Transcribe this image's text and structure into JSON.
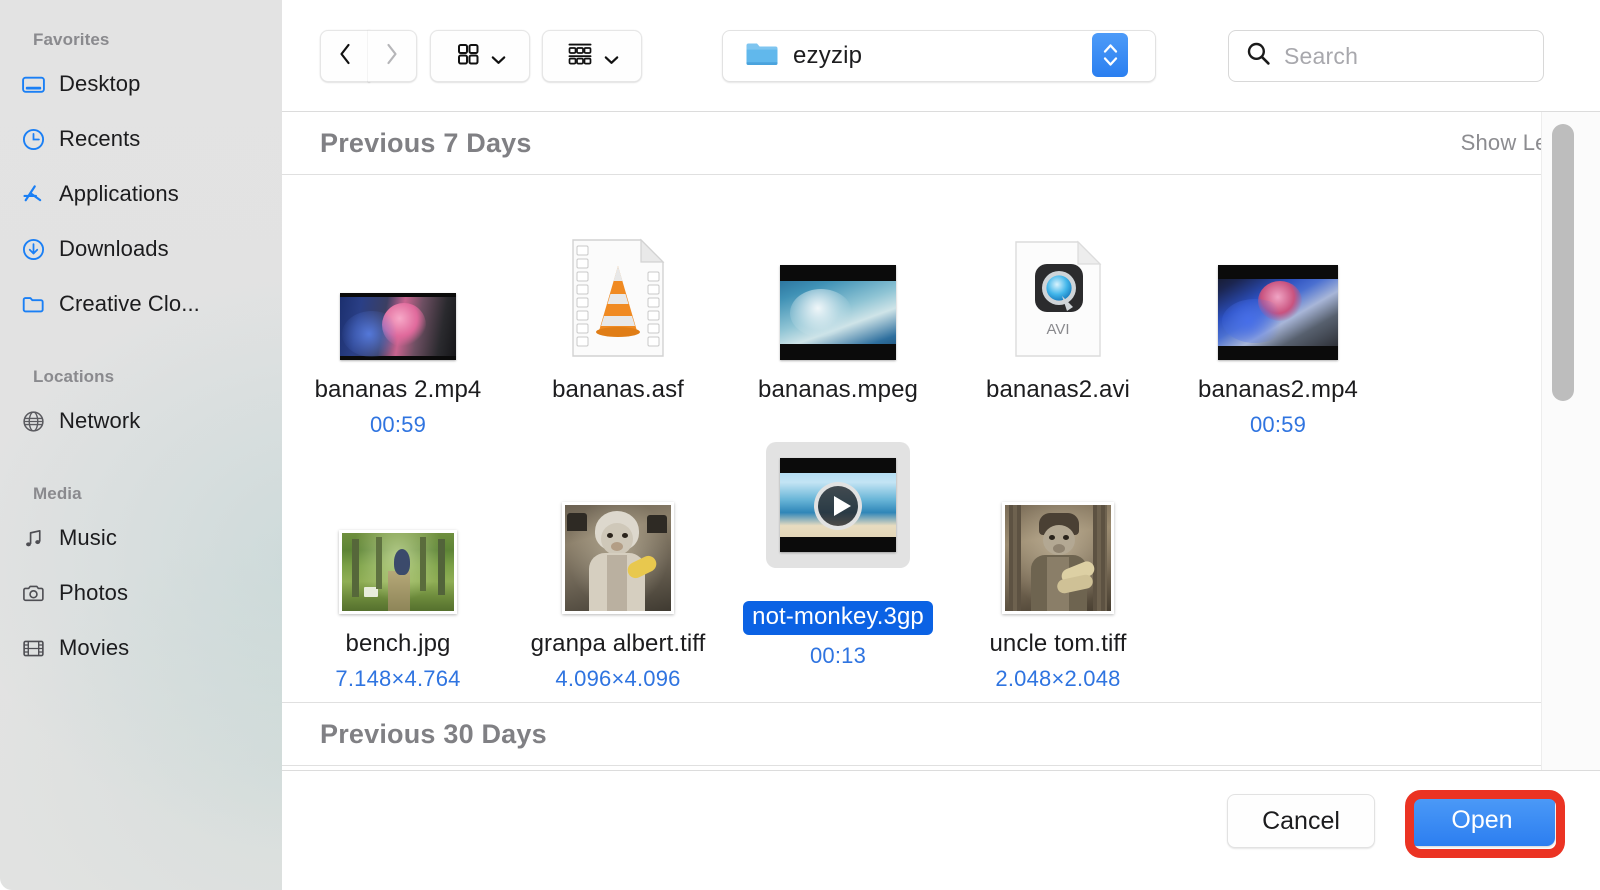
{
  "sidebar": {
    "groups": [
      {
        "title": "Favorites",
        "items": [
          {
            "label": "Desktop",
            "icon": "desktop-icon"
          },
          {
            "label": "Recents",
            "icon": "clock-icon"
          },
          {
            "label": "Applications",
            "icon": "applications-icon"
          },
          {
            "label": "Downloads",
            "icon": "download-icon"
          },
          {
            "label": "Creative Clo...",
            "icon": "folder-icon"
          }
        ]
      },
      {
        "title": "Locations",
        "items": [
          {
            "label": "Network",
            "icon": "globe-icon"
          }
        ]
      },
      {
        "title": "Media",
        "items": [
          {
            "label": "Music",
            "icon": "music-note-icon"
          },
          {
            "label": "Photos",
            "icon": "camera-icon"
          },
          {
            "label": "Movies",
            "icon": "film-icon"
          }
        ]
      }
    ]
  },
  "toolbar": {
    "back_icon": "chevron-left-icon",
    "forward_icon": "chevron-right-icon",
    "view_mode_icon": "grid-view-icon",
    "group_mode_icon": "group-by-icon",
    "dropdown_icon": "chevron-down-icon",
    "path_label": "ezyzip",
    "path_icon": "blue-folder-icon",
    "stepper_icon": "up-down-stepper-icon",
    "search_icon": "search-icon",
    "search_placeholder": "Search",
    "search_value": ""
  },
  "sections": [
    {
      "title": "Previous 7 Days",
      "action": "Show Less"
    },
    {
      "title": "Previous 30 Days",
      "action": ""
    }
  ],
  "files": [
    {
      "name": "bananas 2.mp4",
      "meta": "00:59",
      "thumb": "video-smoke-pink",
      "selected": false
    },
    {
      "name": "bananas.asf",
      "meta": "",
      "thumb": "vlc-cone-doc",
      "selected": false
    },
    {
      "name": "bananas.mpeg",
      "meta": "",
      "thumb": "video-wave",
      "selected": false
    },
    {
      "name": "bananas2.avi",
      "meta": "",
      "thumb": "quicktime-avi-doc",
      "selected": false,
      "badge": "AVI"
    },
    {
      "name": "bananas2.mp4",
      "meta": "00:59",
      "thumb": "video-smoke-blue",
      "selected": false
    },
    {
      "name": "bench.jpg",
      "meta": "7.148×4.764",
      "thumb": "photo-forest",
      "selected": false
    },
    {
      "name": "granpa albert.tiff",
      "meta": "4.096×4.096",
      "thumb": "photo-monkey-banana",
      "selected": false
    },
    {
      "name": "not-monkey.3gp",
      "meta": "00:13",
      "thumb": "video-beach-play",
      "selected": true
    },
    {
      "name": "uncle tom.tiff",
      "meta": "2.048×2.048",
      "thumb": "photo-monkey-pilot",
      "selected": false
    }
  ],
  "footer": {
    "cancel_label": "Cancel",
    "open_label": "Open"
  },
  "colors": {
    "accent_blue": "#2c7ef0",
    "selection_blue": "#0b62e4",
    "meta_blue": "#2f74e0",
    "annotation_red": "#eb3323",
    "sidebar_bg": "#e3e3e3"
  },
  "annotation": {
    "target": "open-button",
    "shape": "rounded-rectangle-outline"
  }
}
